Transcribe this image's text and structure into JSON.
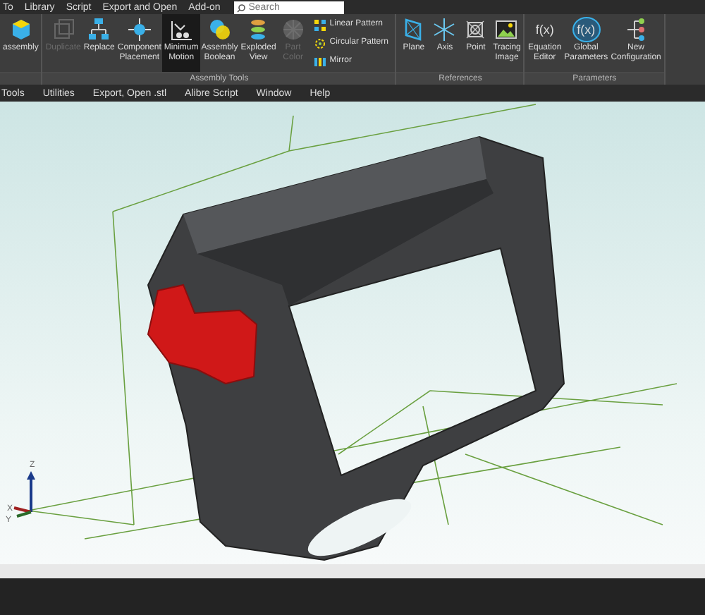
{
  "top_menu": {
    "items": [
      "To",
      "Library",
      "Script",
      "Export and Open",
      "Add-on"
    ],
    "search": {
      "placeholder": "Search"
    }
  },
  "ribbon": {
    "groups": [
      {
        "items": [
          {
            "kind": "large",
            "label": "assembly",
            "disabled": false,
            "selected": false
          }
        ]
      },
      {
        "label": "Assembly Tools",
        "items": [
          {
            "kind": "large",
            "label": "Duplicate",
            "disabled": true,
            "selected": false
          },
          {
            "kind": "large",
            "label": "Replace",
            "disabled": false,
            "selected": false
          },
          {
            "kind": "large",
            "label": "Component Placement",
            "disabled": false,
            "selected": false
          },
          {
            "kind": "large",
            "label": "Minimum Motion",
            "disabled": false,
            "selected": true
          },
          {
            "kind": "large",
            "label": "Assembly Boolean",
            "disabled": false,
            "selected": false
          },
          {
            "kind": "large",
            "label": "Exploded View",
            "disabled": false,
            "selected": false
          },
          {
            "kind": "large",
            "label": "Part Color",
            "disabled": true,
            "selected": false
          },
          {
            "kind": "small",
            "label": "Linear Pattern",
            "disabled": false,
            "selected": false
          },
          {
            "kind": "small",
            "label": "Circular Pattern",
            "disabled": false,
            "selected": false
          },
          {
            "kind": "small",
            "label": "Mirror",
            "disabled": false,
            "selected": false
          }
        ]
      },
      {
        "label": "References",
        "items": [
          {
            "kind": "large",
            "label": "Plane",
            "disabled": false,
            "selected": false
          },
          {
            "kind": "large",
            "label": "Axis",
            "disabled": false,
            "selected": false
          },
          {
            "kind": "large",
            "label": "Point",
            "disabled": false,
            "selected": false
          },
          {
            "kind": "large",
            "label": "Tracing Image",
            "disabled": false,
            "selected": false
          }
        ]
      },
      {
        "label": "Parameters",
        "items": [
          {
            "kind": "large",
            "label": "Equation Editor",
            "icon_text": "f(x)",
            "disabled": false,
            "selected": false
          },
          {
            "kind": "large",
            "label": "Global Parameters",
            "icon_text": "f(x)",
            "disabled": false,
            "selected": false
          },
          {
            "kind": "large",
            "label": "New Configuration",
            "disabled": false,
            "selected": false
          }
        ]
      }
    ]
  },
  "menu_bar": {
    "items": [
      "Tools",
      "Utilities",
      "Export, Open .stl",
      "Alibre Script",
      "Window",
      "Help"
    ]
  },
  "viewport": {
    "axis_labels": [
      "Z",
      "X",
      "Y"
    ]
  }
}
